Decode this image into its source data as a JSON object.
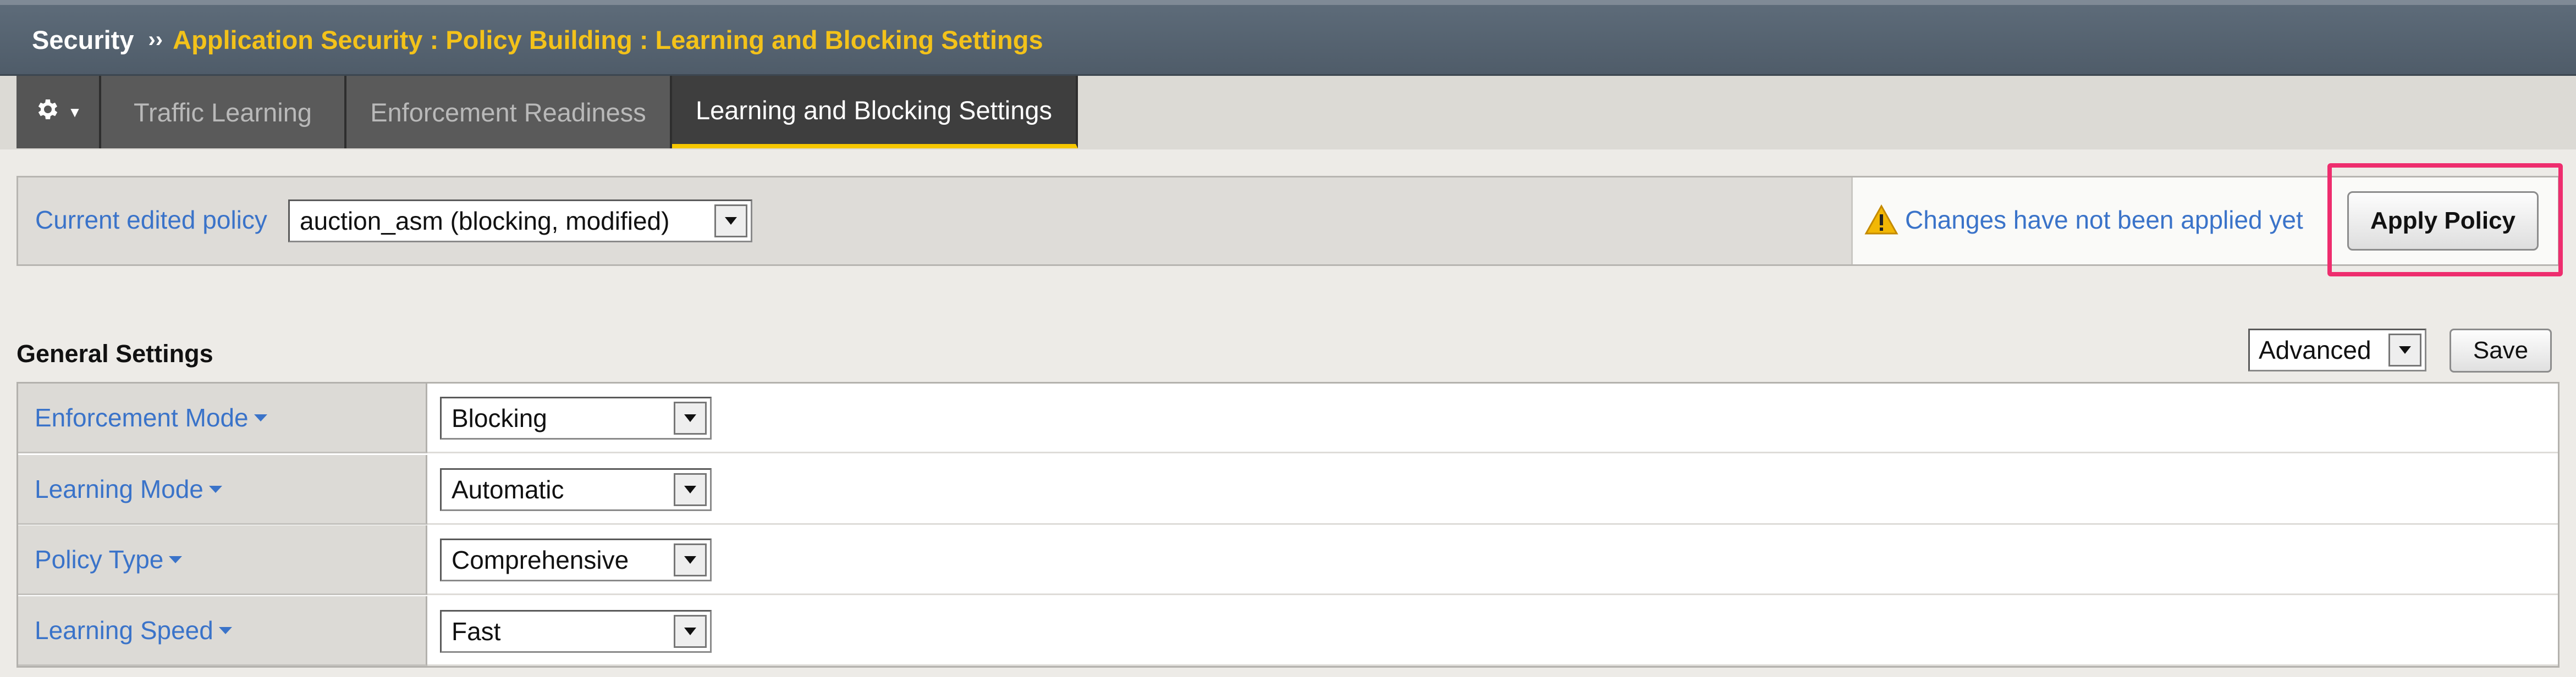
{
  "breadcrumb": {
    "root": "Security",
    "separator": "››",
    "path": "Application Security : Policy Building : Learning and Blocking Settings"
  },
  "tabs": {
    "gear_icon": "gear-icon",
    "items": [
      {
        "label": "Traffic Learning",
        "active": false
      },
      {
        "label": "Enforcement Readiness",
        "active": false
      },
      {
        "label": "Learning and Blocking Settings",
        "active": true
      }
    ]
  },
  "policy_bar": {
    "label": "Current edited policy",
    "selected_policy": "auction_asm (blocking, modified)",
    "notice": "Changes have not been applied yet",
    "apply_label": "Apply Policy"
  },
  "general_settings": {
    "title": "General Settings",
    "view_mode": "Advanced",
    "save_label": "Save",
    "rows": [
      {
        "label": "Enforcement Mode",
        "value": "Blocking"
      },
      {
        "label": "Learning Mode",
        "value": "Automatic"
      },
      {
        "label": "Policy Type",
        "value": "Comprehensive"
      },
      {
        "label": "Learning Speed",
        "value": "Fast"
      }
    ]
  },
  "colors": {
    "accent_yellow": "#f3c21a",
    "link_blue": "#3a73c9",
    "highlight_pink": "#ee2d6e",
    "warning_yellow": "#f2b705"
  }
}
